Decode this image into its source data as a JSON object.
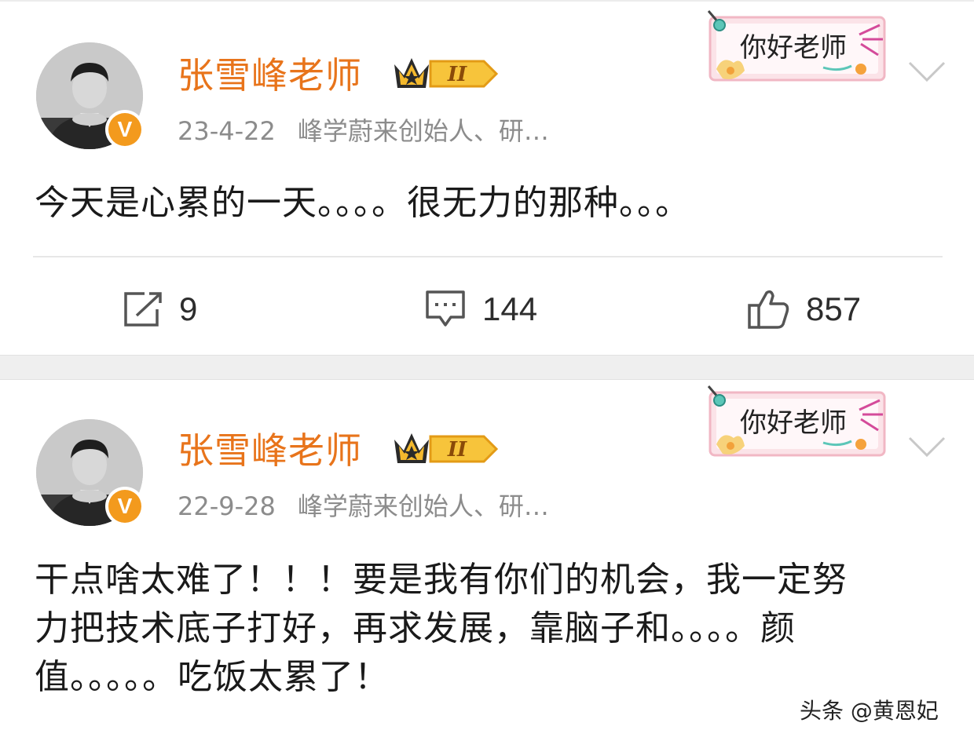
{
  "posts": [
    {
      "author": "张雪峰老师",
      "level_badge": "II",
      "verified_badge": "V",
      "sticker_text": "你好老师",
      "date": "23-4-22",
      "bio": "峰学蔚来创始人、研…",
      "content": "今天是心累的一天。。。。很无力的那种。。。",
      "actions": {
        "repost_count": "9",
        "comment_count": "144",
        "like_count": "857"
      }
    },
    {
      "author": "张雪峰老师",
      "level_badge": "II",
      "verified_badge": "V",
      "sticker_text": "你好老师",
      "date": "22-9-28",
      "bio": "峰学蔚来创始人、研…",
      "content": "干点啥太难了！！！要是我有你们的机会，我一定努力把技术底子打好，再求发展，靠脑子和。。。。颜值。。。。。吃饭太累了！"
    }
  ],
  "watermark": "头条 @黄恩妃",
  "colors": {
    "username": "#e8741b",
    "meta": "#8c8c8c",
    "verified": "#f39a1d",
    "icon": "#555555",
    "separator": "#efefef"
  },
  "icons": {
    "repost": "repost-icon",
    "comment": "comment-icon",
    "like": "thumbs-up-icon",
    "more": "chevron-down-icon"
  }
}
